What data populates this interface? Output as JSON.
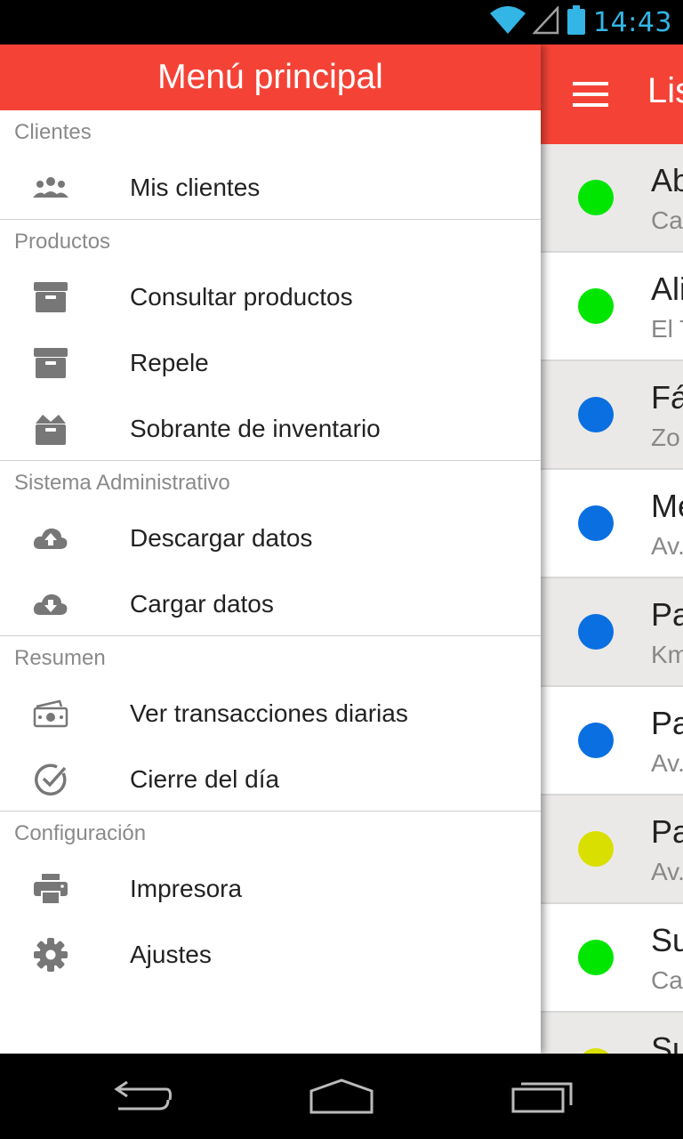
{
  "status_bar": {
    "time": "14:43",
    "icons": [
      "wifi-icon",
      "signal-icon",
      "battery-icon"
    ],
    "accent_color": "#33b5e5"
  },
  "app": {
    "title": "Lis",
    "app_bar_color": "#f44336",
    "clients": [
      {
        "name": "Ab",
        "address": "Ca",
        "status_color": "#00e600",
        "alt": true
      },
      {
        "name": "Ali",
        "address": "El T",
        "status_color": "#00e600",
        "alt": false
      },
      {
        "name": "Fá",
        "address": "Zo",
        "status_color": "#0a6fe0",
        "alt": true
      },
      {
        "name": "Me",
        "address": "Av.",
        "status_color": "#0a6fe0",
        "alt": false
      },
      {
        "name": "Pa",
        "address": "Km",
        "status_color": "#0a6fe0",
        "alt": true
      },
      {
        "name": "Pa",
        "address": "Av.",
        "status_color": "#0a6fe0",
        "alt": false
      },
      {
        "name": "Pa",
        "address": "Av.",
        "status_color": "#d9e000",
        "alt": true
      },
      {
        "name": "Su",
        "address": "Ca",
        "status_color": "#00e600",
        "alt": false
      },
      {
        "name": "Su",
        "address": "",
        "status_color": "#d9e000",
        "alt": true
      }
    ]
  },
  "drawer": {
    "title": "Menú principal",
    "sections": [
      {
        "title": "Clientes",
        "items": [
          {
            "label": "Mis clientes",
            "icon": "group-icon"
          }
        ]
      },
      {
        "title": "Productos",
        "items": [
          {
            "label": "Consultar productos",
            "icon": "archive-box-icon"
          },
          {
            "label": "Repele",
            "icon": "archive-box-icon"
          },
          {
            "label": "Sobrante de inventario",
            "icon": "open-box-icon"
          }
        ]
      },
      {
        "title": "Sistema Administrativo",
        "items": [
          {
            "label": "Descargar datos",
            "icon": "cloud-upload-icon"
          },
          {
            "label": "Cargar datos",
            "icon": "cloud-download-icon"
          }
        ]
      },
      {
        "title": "Resumen",
        "items": [
          {
            "label": "Ver transacciones diarias",
            "icon": "money-stack-icon"
          },
          {
            "label": "Cierre del día",
            "icon": "check-circle-icon"
          }
        ]
      },
      {
        "title": "Configuración",
        "items": [
          {
            "label": "Impresora",
            "icon": "printer-icon"
          },
          {
            "label": "Ajustes",
            "icon": "gear-icon"
          }
        ]
      }
    ]
  },
  "nav_bar": {
    "buttons": [
      "back-icon",
      "home-icon",
      "recents-icon"
    ]
  }
}
